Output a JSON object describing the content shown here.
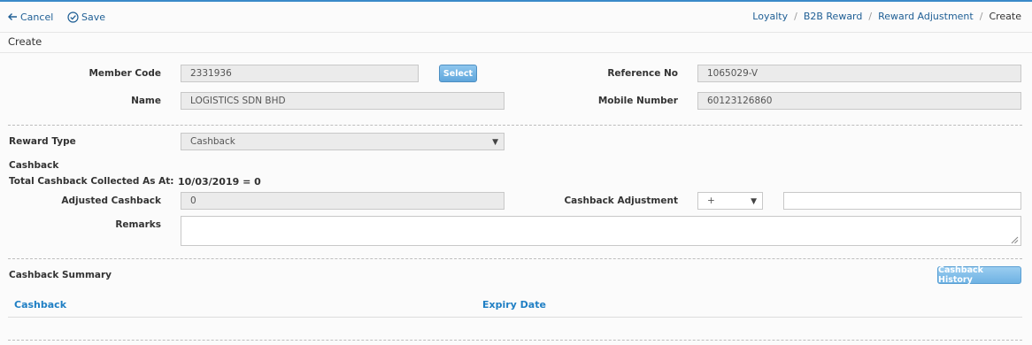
{
  "toolbar": {
    "cancel_label": "Cancel",
    "save_label": "Save"
  },
  "breadcrumb": {
    "items": [
      "Loyalty",
      "B2B Reward",
      "Reward Adjustment"
    ],
    "current": "Create",
    "separator": "/"
  },
  "page": {
    "title": "Create"
  },
  "member": {
    "member_code_label": "Member Code",
    "member_code_value": "2331936",
    "select_button": "Select",
    "name_label": "Name",
    "name_value": "LOGISTICS SDN BHD",
    "reference_no_label": "Reference No",
    "reference_no_value": "1065029-V",
    "mobile_label": "Mobile Number",
    "mobile_value": "60123126860"
  },
  "reward": {
    "type_label": "Reward Type",
    "type_value": "Cashback",
    "cashback_heading": "Cashback",
    "total_label": "Total Cashback Collected As At:",
    "total_value": "10/03/2019 = 0",
    "adjusted_label": "Adjusted Cashback",
    "adjusted_value": "0",
    "adjustment_label": "Cashback Adjustment",
    "adjustment_operator": "+",
    "adjustment_value": "",
    "remarks_label": "Remarks",
    "remarks_value": ""
  },
  "summary": {
    "title": "Cashback Summary",
    "history_button": "Cashback History",
    "columns": [
      "Cashback",
      "Expiry Date"
    ]
  },
  "colors": {
    "accent": "#3a8ac9",
    "link": "#1f5f95",
    "column_link": "#1f7fc4",
    "button_bg": "#5fa6dc"
  }
}
